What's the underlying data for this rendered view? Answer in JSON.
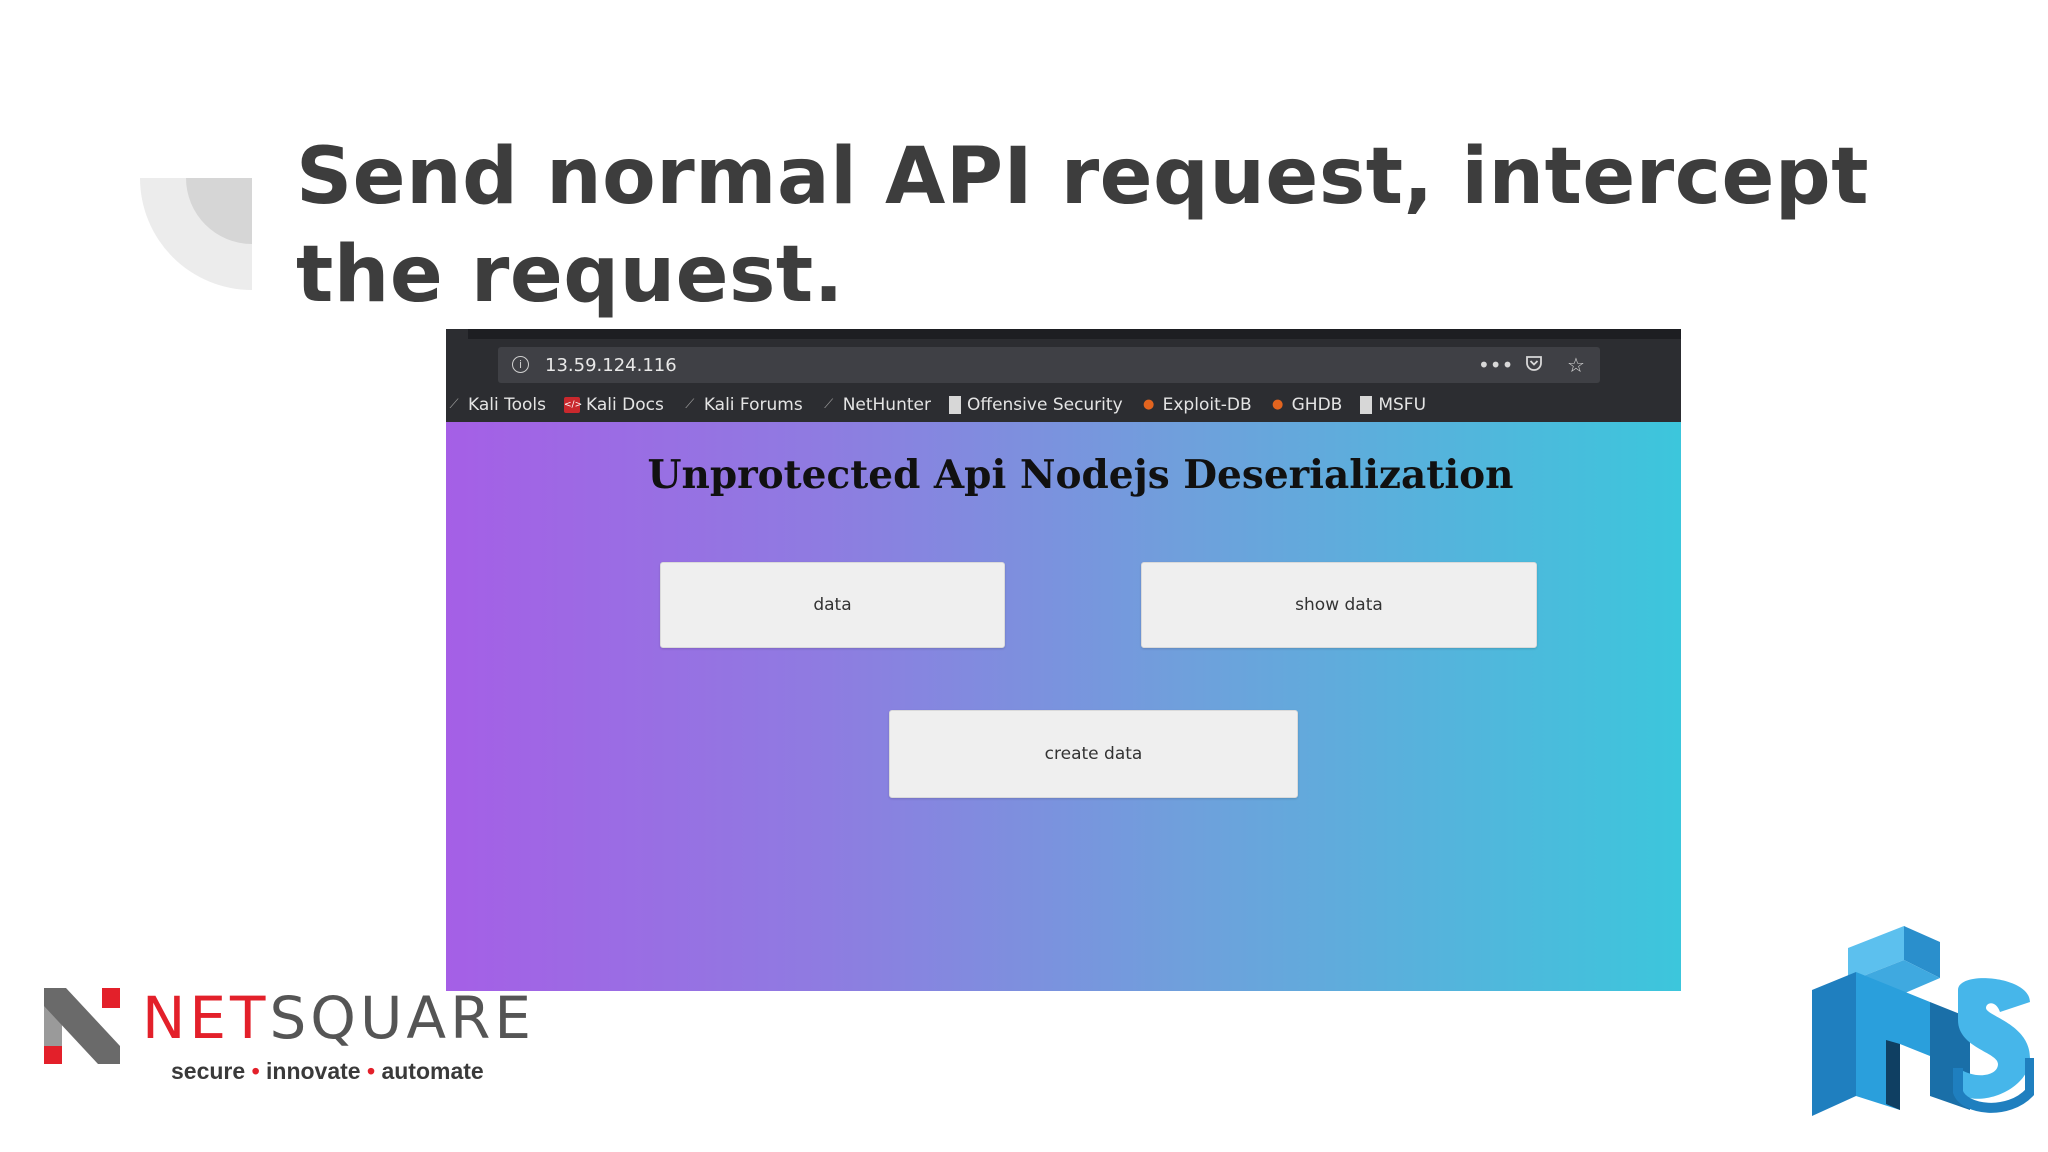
{
  "slide": {
    "title": "Send normal API request, intercept the request."
  },
  "browser": {
    "url": "13.59.124.116",
    "url_actions": [
      "more-icon",
      "pocket-icon",
      "star-icon"
    ],
    "bookmarks": [
      {
        "label": "Kali Tools",
        "icon": "kali-dragon-icon"
      },
      {
        "label": "Kali Docs",
        "icon": "kali-docs-icon"
      },
      {
        "label": "Kali Forums",
        "icon": "kali-dragon-icon"
      },
      {
        "label": "NetHunter",
        "icon": "kali-dragon-icon"
      },
      {
        "label": "Offensive Security",
        "icon": "offsec-icon"
      },
      {
        "label": "Exploit-DB",
        "icon": "exploit-db-icon"
      },
      {
        "label": "GHDB",
        "icon": "exploit-db-icon"
      },
      {
        "label": "MSFU",
        "icon": "offsec-icon"
      }
    ]
  },
  "page": {
    "heading": "Unprotected Api Nodejs Deserialization",
    "buttons": {
      "data": "data",
      "show_data": "show data",
      "create_data": "create data"
    },
    "gradient_colors": [
      "#a55fe6",
      "#3cc6dc"
    ]
  },
  "branding": {
    "logo_net": "NET",
    "logo_square": "SQUARE",
    "tagline_1": "secure",
    "tagline_2": "innovate",
    "tagline_3": "automate",
    "tagline_sep": "•",
    "brand_red": "#e3202a",
    "brand_blue": "#2a9fdc"
  }
}
